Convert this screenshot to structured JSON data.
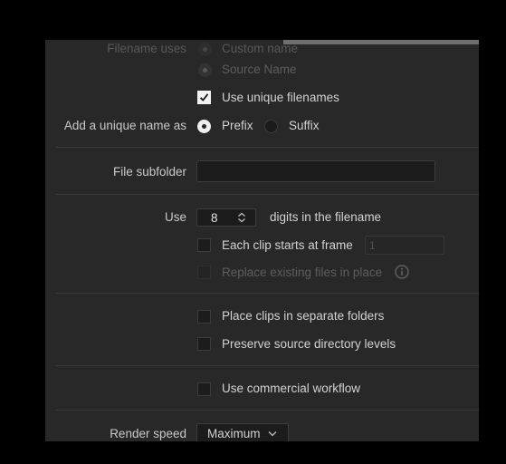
{
  "filename": {
    "label": "Filename uses",
    "option_custom": "Custom name",
    "option_source": "Source Name"
  },
  "unique_filenames_label": "Use unique filenames",
  "add_unique": {
    "label": "Add a unique name as",
    "prefix": "Prefix",
    "suffix": "Suffix"
  },
  "file_subfolder": {
    "label": "File subfolder",
    "value": ""
  },
  "digits": {
    "label": "Use",
    "value": "8",
    "suffix": "digits in the filename"
  },
  "each_clip": {
    "label": "Each clip starts at frame",
    "value": "1"
  },
  "replace_label": "Replace existing files in place",
  "separate_folders_label": "Place clips in separate folders",
  "preserve_dirs_label": "Preserve source directory levels",
  "commercial_label": "Use commercial workflow",
  "render_speed": {
    "label": "Render speed",
    "value": "Maximum"
  },
  "colors": {
    "panel": "#282828",
    "accent_white": "#efefef",
    "disabled": "#5d5d5d"
  },
  "icons": [
    "checkmark-icon",
    "stepper-icon",
    "chevron-down-icon",
    "info-icon"
  ]
}
